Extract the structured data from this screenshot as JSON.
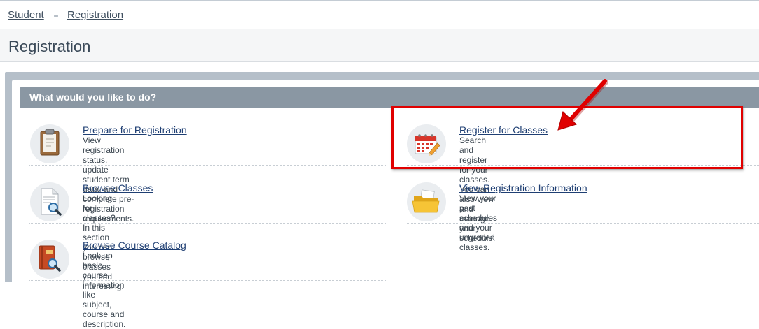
{
  "breadcrumb": {
    "items": [
      "Student",
      "Registration"
    ]
  },
  "page": {
    "title": "Registration"
  },
  "panel": {
    "header": "What would you like to do?"
  },
  "options": [
    {
      "title": "Prepare for Registration",
      "desc_line1": "View registration status, update student term data, and complete pre-registration",
      "desc_line2": "requirements.",
      "icon": "clipboard-icon"
    },
    {
      "title": "Register for Classes",
      "desc_line1": "Search and register for your classes. You can also view and manage your",
      "desc_line2": "schedule.",
      "icon": "calendar-icon"
    },
    {
      "title": "Browse Classes",
      "desc_line1": "Looking for classes? In this section you can browse classes you find interesting.",
      "desc_line2": "",
      "icon": "document-search-icon"
    },
    {
      "title": "View Registration Information",
      "desc_line1": "View your past schedules and your ungraded classes.",
      "desc_line2": "",
      "icon": "folder-icon"
    },
    {
      "title": "Browse Course Catalog",
      "desc_line1": "Look up basic course information like subject, course and description.",
      "desc_line2": "",
      "icon": "book-search-icon"
    }
  ],
  "colors": {
    "link": "#1f3f73",
    "header": "#8a97a3",
    "annotation": "#e00000"
  }
}
